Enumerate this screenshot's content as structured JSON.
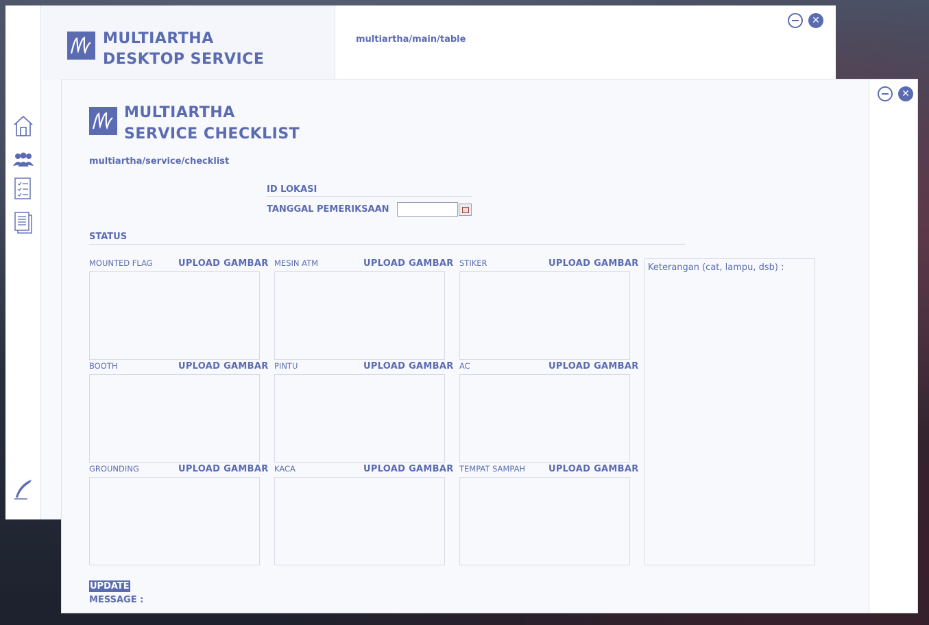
{
  "back_window": {
    "app_title_line1": "MULTIARTHA",
    "app_title_line2": "DESKTOP SERVICE",
    "path": "multiartha/main/table",
    "close_symbol": "✕",
    "nav_icons": [
      "home-icon",
      "users-icon",
      "checklist-icon",
      "documents-icon",
      "quill-icon"
    ]
  },
  "front_window": {
    "title_line1": "MULTIARTHA",
    "title_line2": "SERVICE CHECKLIST",
    "path": "multiartha/service/checklist",
    "close_symbol": "✕",
    "id_lokasi_label": "ID LOKASI",
    "tanggal_label": "TANGGAL PEMERIKSAAN",
    "tanggal_value": "",
    "status_label": "STATUS",
    "upload_label": "UPLOAD GAMBAR",
    "items": [
      {
        "label": "MOUNTED FLAG"
      },
      {
        "label": "MESIN ATM"
      },
      {
        "label": "STIKER"
      },
      {
        "label": "BOOTH"
      },
      {
        "label": "PINTU"
      },
      {
        "label": "AC"
      },
      {
        "label": "GROUNDING"
      },
      {
        "label": "KACA"
      },
      {
        "label": "TEMPAT SAMPAH"
      }
    ],
    "notes_placeholder": "Keterangan (cat, lampu, dsb) :",
    "update_label": "UPDATE",
    "message_label": "MESSAGE :"
  },
  "colors": {
    "accent": "#5b6bb1",
    "panel": "#f8f9fd",
    "border": "#d7dbe8"
  }
}
